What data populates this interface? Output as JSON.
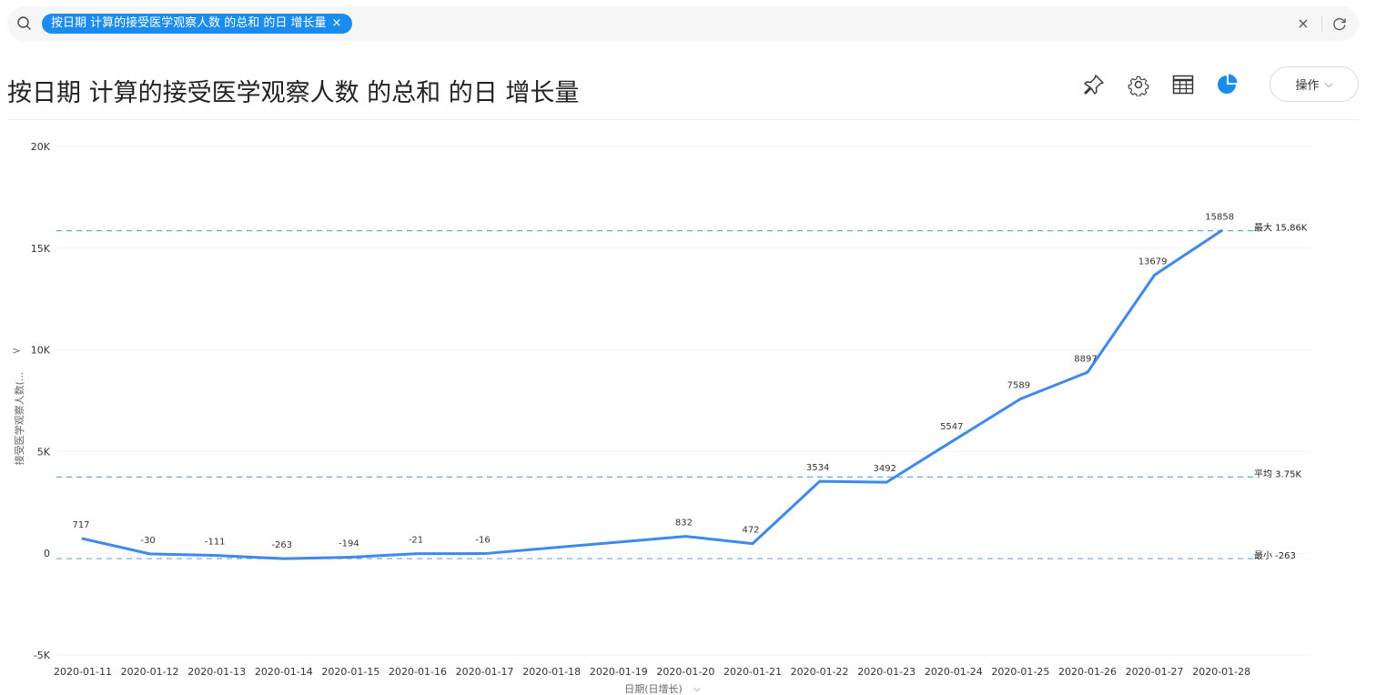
{
  "search": {
    "chip_label": "按日期  计算的接受医学观察人数  的总和  的日 增长量",
    "chip_close": "×",
    "clear": "×"
  },
  "header": {
    "title": "按日期 计算的接受医学观察人数 的总和 的日 增长量",
    "action_label": "操作",
    "action_chevron": "⌵"
  },
  "colors": {
    "accent": "#1a8cf0",
    "line": "#3f88ec",
    "reference": "#6ea4ee",
    "grid": "#f2f2f2"
  },
  "chart_data": {
    "type": "line",
    "categories": [
      "2020-01-11",
      "2020-01-12",
      "2020-01-13",
      "2020-01-14",
      "2020-01-15",
      "2020-01-16",
      "2020-01-17",
      "2020-01-18",
      "2020-01-19",
      "2020-01-20",
      "2020-01-21",
      "2020-01-22",
      "2020-01-23",
      "2020-01-24",
      "2020-01-25",
      "2020-01-26",
      "2020-01-27",
      "2020-01-28"
    ],
    "values": [
      717,
      -30,
      -111,
      -263,
      -194,
      -21,
      -16,
      null,
      null,
      832,
      472,
      3534,
      3492,
      5547,
      7589,
      8897,
      13679,
      15858
    ],
    "data_labels": [
      "717",
      "-30",
      "-111",
      "-263",
      "-194",
      "-21",
      "-16",
      "",
      "",
      "832",
      "472",
      "3534",
      "3492",
      "5547",
      "7589",
      "8897",
      "13679",
      "15858"
    ],
    "ylim": [
      -5000,
      20000
    ],
    "yticks": [
      -5000,
      0,
      5000,
      10000,
      15000,
      20000
    ],
    "ytick_labels": [
      "-5K",
      "0",
      "5K",
      "10K",
      "15K",
      "20K"
    ],
    "xlabel": "日期(日增长)",
    "ylabel": "接受医学观察人数(...",
    "ylabel_toggle": ">",
    "x_dropdown": "⌵",
    "reference_lines": [
      {
        "label": "最大 15.86K",
        "value": 15858
      },
      {
        "label": "平均 3.75K",
        "value": 3750
      },
      {
        "label": "最小 -263",
        "value": -263
      }
    ],
    "grid": true
  }
}
